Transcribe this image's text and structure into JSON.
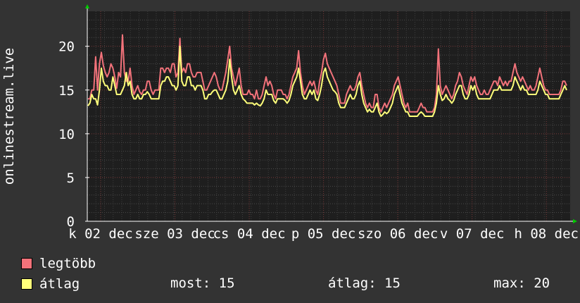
{
  "chart_data": {
    "type": "line",
    "ylabel": "onlinestream.live",
    "ylim": [
      0,
      24
    ],
    "yticks": [
      0,
      5,
      10,
      15,
      20
    ],
    "x_tick_labels": [
      "k 02 dec",
      "sze 03 dec",
      "cs 04 dec",
      "p 05 dec",
      "szo 06 dec",
      "v 07 dec",
      "h 08 dec"
    ],
    "grid": true,
    "colors": {
      "legtobb": "#f2727a",
      "atlag": "#ffff7a",
      "background": "#333333",
      "plot": "#1e1e1e",
      "axis": "#ffffff"
    },
    "series": [
      {
        "name": "legtöbb",
        "color": "#f2727a",
        "values": [
          14.0,
          14.0,
          15.0,
          15.0,
          18.8,
          15.0,
          18.0,
          19.3,
          17.8,
          17.0,
          16.5,
          17.0,
          18.0,
          17.5,
          16.5,
          15.2,
          17.0,
          16.5,
          21.3,
          17.0,
          16.0,
          16.0,
          17.5,
          15.5,
          14.5,
          15.0,
          15.5,
          14.8,
          14.5,
          15.0,
          15.0,
          16.0,
          16.0,
          15.0,
          14.5,
          15.0,
          15.0,
          15.0,
          17.5,
          17.5,
          17.0,
          17.5,
          17.5,
          17.0,
          18.0,
          18.0,
          16.5,
          17.0,
          20.9,
          17.0,
          17.5,
          17.0,
          18.0,
          18.0,
          17.0,
          16.5,
          16.5,
          17.0,
          17.0,
          17.0,
          16.0,
          15.0,
          15.0,
          15.5,
          16.0,
          16.5,
          17.0,
          16.5,
          15.5,
          15.0,
          15.0,
          16.0,
          17.0,
          18.5,
          20.0,
          17.5,
          16.5,
          15.5,
          16.5,
          17.5,
          15.5,
          14.5,
          14.5,
          14.5,
          15.0,
          14.5,
          14.5,
          14.0,
          15.0,
          14.0,
          14.0,
          14.5,
          15.5,
          16.5,
          15.5,
          16.0,
          15.5,
          14.5,
          14.0,
          15.0,
          15.0,
          15.0,
          14.5,
          14.5,
          14.0,
          14.5,
          15.5,
          16.5,
          17.0,
          17.5,
          19.5,
          17.0,
          15.5,
          14.5,
          15.0,
          15.5,
          16.0,
          15.5,
          16.0,
          15.0,
          14.5,
          16.0,
          17.0,
          18.5,
          19.2,
          18.0,
          17.5,
          17.0,
          16.5,
          16.0,
          15.5,
          14.5,
          13.5,
          13.5,
          13.5,
          14.5,
          15.0,
          15.5,
          15.0,
          15.0,
          15.5,
          16.5,
          17.0,
          15.5,
          14.5,
          13.5,
          13.0,
          13.5,
          13.0,
          13.0,
          14.5,
          14.5,
          13.0,
          12.5,
          13.0,
          13.5,
          13.0,
          13.5,
          14.0,
          14.5,
          15.5,
          16.0,
          16.5,
          15.5,
          14.5,
          13.5,
          13.0,
          13.5,
          12.5,
          12.5,
          12.5,
          12.5,
          12.5,
          13.0,
          13.5,
          13.0,
          13.0,
          12.5,
          12.5,
          12.5,
          12.5,
          13.0,
          14.5,
          19.7,
          15.5,
          14.5,
          15.0,
          15.5,
          15.0,
          14.5,
          14.0,
          14.5,
          15.5,
          16.0,
          17.0,
          16.5,
          15.5,
          15.0,
          14.5,
          15.5,
          16.5,
          16.0,
          16.5,
          15.5,
          15.0,
          14.5,
          14.5,
          15.0,
          14.5,
          14.5,
          15.0,
          15.5,
          16.0,
          16.0,
          15.5,
          16.5,
          16.0,
          15.5,
          16.0,
          15.5,
          16.0,
          16.0,
          17.0,
          18.0,
          17.0,
          16.5,
          16.0,
          16.5,
          16.0,
          15.5,
          15.0,
          15.5,
          15.0,
          15.0,
          15.5,
          16.5,
          17.5,
          16.5,
          15.5,
          15.0,
          15.0,
          14.5,
          14.5,
          14.5,
          14.5,
          14.5,
          14.5,
          15.0,
          16.0,
          16.0,
          15.5
        ]
      },
      {
        "name": "átlag",
        "color": "#ffff7a",
        "values": [
          13.2,
          13.5,
          14.5,
          14.0,
          14.0,
          13.3,
          15.0,
          17.5,
          16.0,
          15.5,
          15.5,
          15.0,
          15.0,
          16.5,
          15.5,
          14.5,
          14.5,
          14.5,
          15.0,
          15.5,
          17.0,
          15.5,
          16.0,
          14.5,
          14.0,
          14.0,
          14.5,
          14.0,
          14.0,
          14.5,
          14.5,
          14.8,
          14.5,
          14.0,
          14.0,
          14.0,
          14.0,
          14.0,
          15.5,
          16.0,
          16.0,
          16.5,
          16.5,
          16.0,
          15.5,
          15.5,
          15.0,
          15.5,
          20.0,
          16.0,
          15.5,
          15.5,
          16.5,
          16.5,
          15.5,
          15.5,
          15.0,
          15.5,
          15.5,
          15.5,
          15.0,
          14.0,
          14.0,
          14.5,
          14.5,
          14.8,
          15.0,
          15.0,
          14.5,
          14.0,
          14.0,
          14.5,
          15.0,
          16.0,
          18.5,
          16.5,
          15.0,
          14.5,
          15.0,
          15.5,
          14.5,
          14.0,
          13.8,
          13.5,
          13.5,
          13.5,
          13.5,
          13.3,
          13.5,
          13.3,
          13.2,
          13.5,
          14.0,
          15.0,
          14.5,
          14.5,
          14.5,
          13.8,
          13.5,
          14.0,
          14.0,
          14.0,
          14.0,
          13.8,
          13.5,
          13.8,
          14.5,
          15.5,
          16.0,
          16.5,
          17.5,
          16.0,
          14.5,
          14.0,
          14.0,
          14.5,
          15.0,
          14.5,
          15.0,
          14.0,
          13.8,
          14.5,
          15.5,
          17.0,
          17.5,
          16.5,
          16.0,
          15.5,
          15.0,
          14.8,
          14.5,
          13.5,
          13.0,
          13.0,
          13.0,
          13.5,
          14.0,
          14.5,
          14.0,
          14.0,
          14.5,
          15.5,
          16.0,
          14.5,
          13.5,
          13.0,
          12.5,
          12.8,
          12.5,
          12.5,
          13.0,
          13.5,
          12.5,
          12.0,
          12.2,
          12.5,
          12.3,
          12.5,
          13.0,
          13.5,
          14.5,
          15.0,
          15.5,
          14.5,
          13.5,
          13.0,
          12.5,
          12.5,
          12.0,
          12.0,
          12.0,
          12.0,
          12.0,
          12.3,
          12.5,
          12.3,
          12.0,
          12.0,
          12.0,
          12.0,
          12.0,
          12.5,
          13.5,
          15.5,
          14.5,
          13.8,
          14.0,
          14.5,
          14.0,
          13.8,
          13.5,
          13.8,
          14.5,
          15.0,
          15.5,
          15.5,
          14.5,
          14.0,
          14.0,
          14.5,
          15.5,
          15.0,
          15.5,
          14.5,
          14.0,
          14.0,
          14.0,
          14.0,
          14.0,
          14.0,
          14.0,
          14.5,
          15.0,
          15.0,
          15.0,
          15.5,
          15.0,
          15.0,
          15.0,
          15.0,
          15.0,
          15.0,
          15.5,
          16.5,
          16.0,
          15.5,
          15.0,
          15.5,
          15.0,
          15.0,
          14.5,
          14.5,
          14.5,
          14.5,
          14.5,
          15.0,
          16.0,
          15.5,
          15.0,
          14.5,
          14.5,
          14.0,
          14.0,
          14.0,
          14.0,
          14.0,
          14.0,
          14.5,
          15.0,
          15.5,
          15.0
        ]
      }
    ]
  },
  "legend": {
    "max_label": "legtöbb",
    "avg_label": "átlag"
  },
  "stats": {
    "current": "most: 15",
    "average": "átlag: 15",
    "max": "max: 20"
  }
}
